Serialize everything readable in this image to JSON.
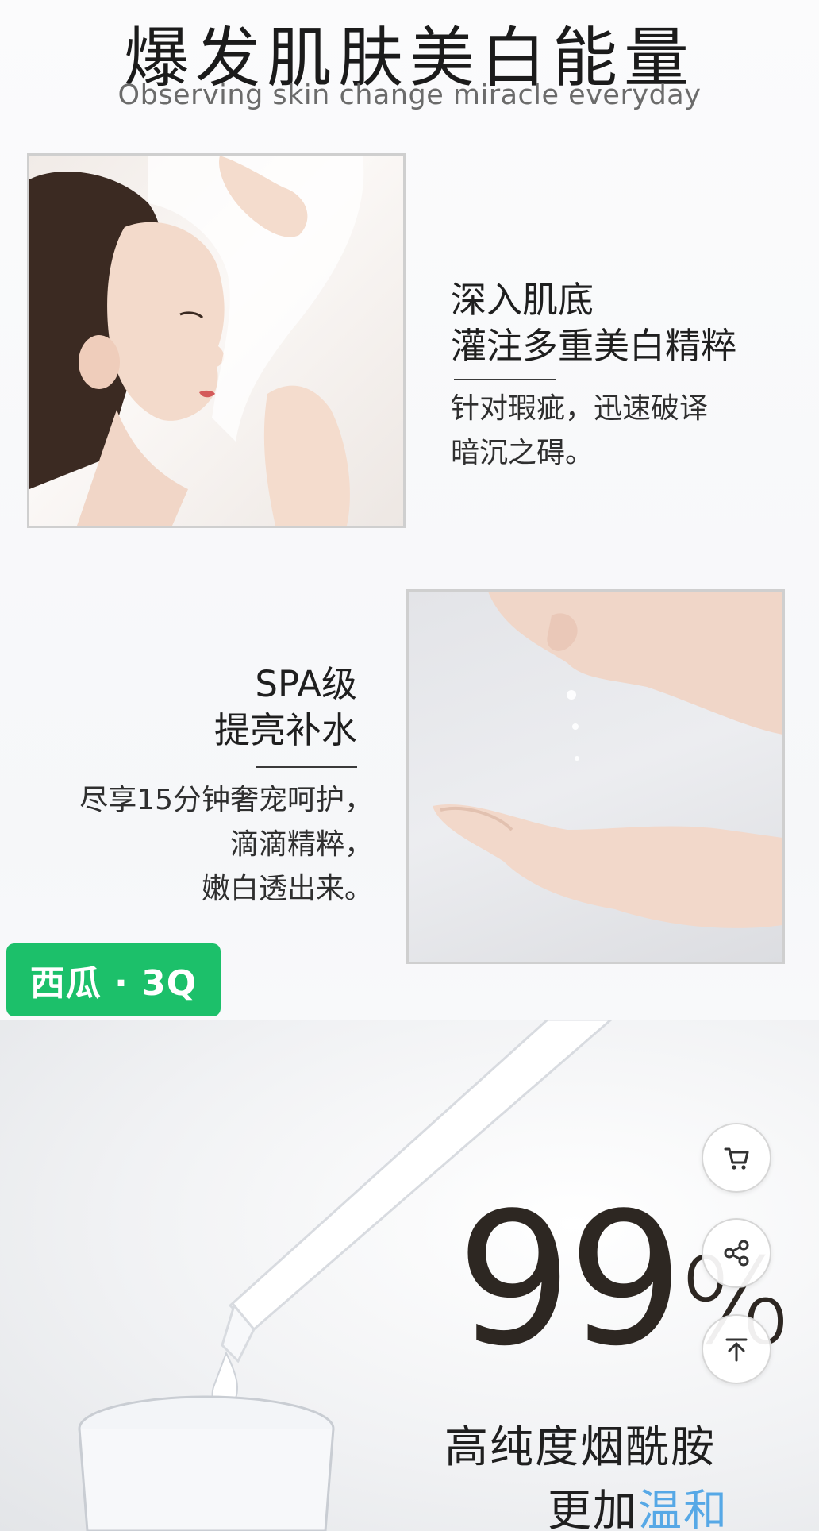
{
  "header": {
    "title": "爆发肌肤美白能量",
    "subtitle": "Observing skin change miracle everyday"
  },
  "features": [
    {
      "title_lines": [
        "深入肌底",
        "灌注多重美白精粹"
      ],
      "desc_lines": [
        "针对瑕疵，迅速破译",
        "暗沉之碍。"
      ]
    },
    {
      "title_lines": [
        "SPA级",
        "提亮补水"
      ],
      "desc_lines": [
        "尽享15分钟奢宠呵护，",
        "滴滴精粹，",
        "嫩白透出来。"
      ]
    }
  ],
  "watermark": {
    "label": "西瓜 · 3Q"
  },
  "promo": {
    "value": "99",
    "unit": "%",
    "line1": "高纯度烟酰胺",
    "line2_prefix": "更加",
    "line2_accent": "温和",
    "accent_color": "#56a8e6"
  },
  "actions": {
    "cart_icon": "cart-icon",
    "share_icon": "share-icon",
    "top_icon": "arrow-up-icon"
  }
}
